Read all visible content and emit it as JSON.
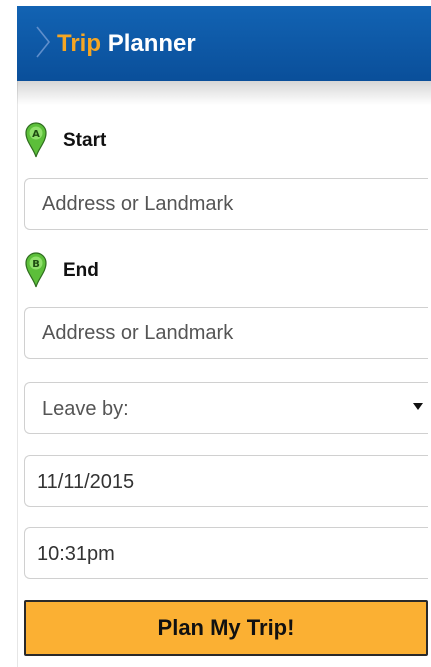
{
  "header": {
    "title_part1": "Trip",
    "title_part2": "Planner",
    "accent": "#f5a623",
    "background": "#0a57a6"
  },
  "start": {
    "marker_letter": "A",
    "label": "Start",
    "placeholder": "Address or Landmark",
    "value": ""
  },
  "end": {
    "marker_letter": "B",
    "label": "End",
    "placeholder": "Address or Landmark",
    "value": ""
  },
  "leave": {
    "selected": "Leave by:"
  },
  "date": {
    "value": "11/11/2015"
  },
  "time": {
    "value": "10:31pm"
  },
  "plan_button": {
    "label": "Plan My Trip!",
    "color": "#fbb033"
  },
  "icons": {
    "header": "chevron-right-icon",
    "start": "map-pin-icon",
    "end": "map-pin-icon",
    "select": "caret-down-icon"
  }
}
